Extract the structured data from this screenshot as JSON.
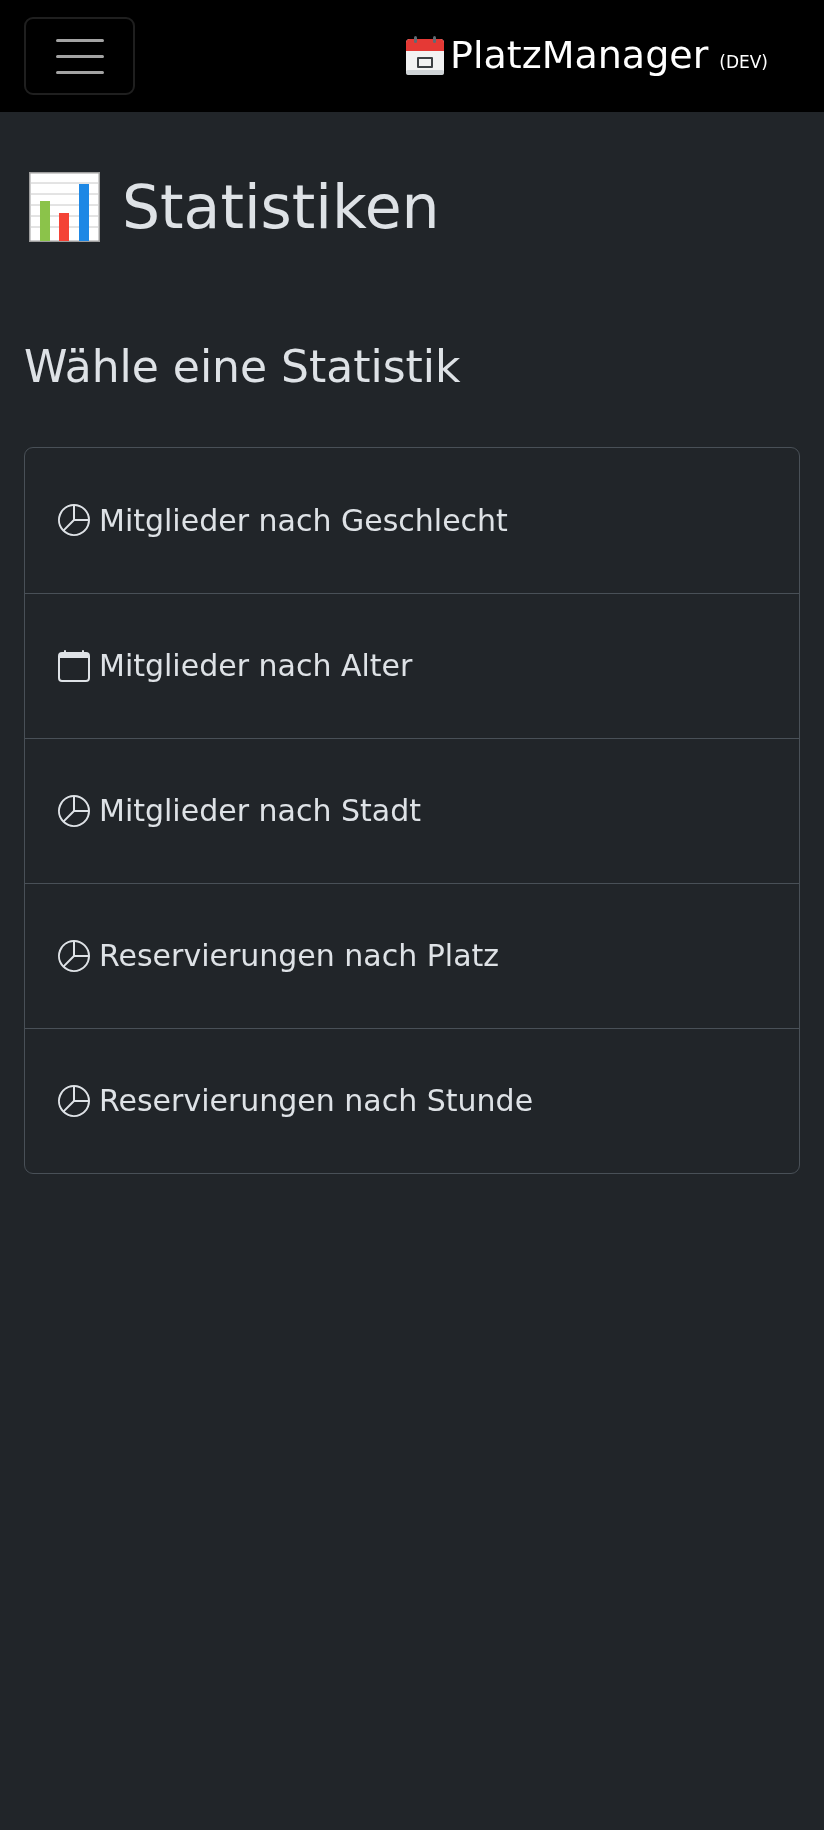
{
  "navbar": {
    "brand": {
      "name": "PlatzManager",
      "badge": "(DEV)"
    }
  },
  "page": {
    "title": "Statistiken",
    "subtitle": "Wähle eine Statistik"
  },
  "statistics": [
    {
      "kind": "pie",
      "label": "Mitglieder nach Geschlecht"
    },
    {
      "kind": "calendar",
      "label": "Mitglieder nach Alter"
    },
    {
      "kind": "pie",
      "label": "Mitglieder nach Stadt"
    },
    {
      "kind": "pie",
      "label": "Reservierungen nach Platz"
    },
    {
      "kind": "pie",
      "label": "Reservierungen nach Stunde"
    }
  ]
}
